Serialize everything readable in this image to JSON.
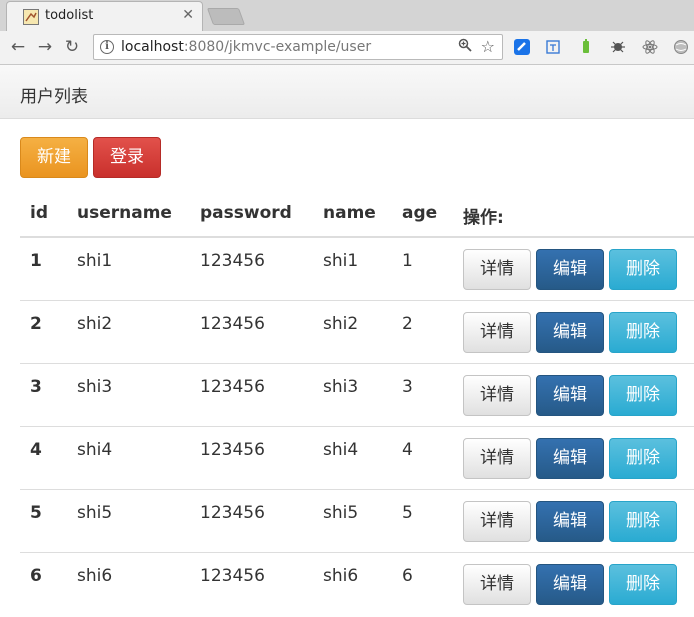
{
  "browser": {
    "tab_title": "todolist",
    "tab_close": "✕",
    "url_host": "localhost",
    "url_rest": ":8080/jkmvc-example/user"
  },
  "page": {
    "title": "用户列表",
    "new_button": "新建",
    "login_button": "登录"
  },
  "table": {
    "columns": [
      "id",
      "username",
      "password",
      "name",
      "age",
      "操作:"
    ],
    "action_labels": {
      "detail": "详情",
      "edit": "编辑",
      "delete": "删除"
    },
    "rows": [
      {
        "id": "1",
        "username": "shi1",
        "password": "123456",
        "name": "shi1",
        "age": "1"
      },
      {
        "id": "2",
        "username": "shi2",
        "password": "123456",
        "name": "shi2",
        "age": "2"
      },
      {
        "id": "3",
        "username": "shi3",
        "password": "123456",
        "name": "shi3",
        "age": "3"
      },
      {
        "id": "4",
        "username": "shi4",
        "password": "123456",
        "name": "shi4",
        "age": "4"
      },
      {
        "id": "5",
        "username": "shi5",
        "password": "123456",
        "name": "shi5",
        "age": "5"
      },
      {
        "id": "6",
        "username": "shi6",
        "password": "123456",
        "name": "shi6",
        "age": "6"
      }
    ]
  },
  "icons": {
    "back": "back-arrow-icon",
    "forward": "forward-arrow-icon",
    "reload": "reload-icon",
    "info": "page-info-icon",
    "zoom": "zoom-icon",
    "bookmark": "bookmark-star-icon"
  },
  "colors": {
    "new_button": "#ec971f",
    "login_button": "#c9302c",
    "edit_button": "#286090",
    "delete_button": "#31b0d5"
  }
}
